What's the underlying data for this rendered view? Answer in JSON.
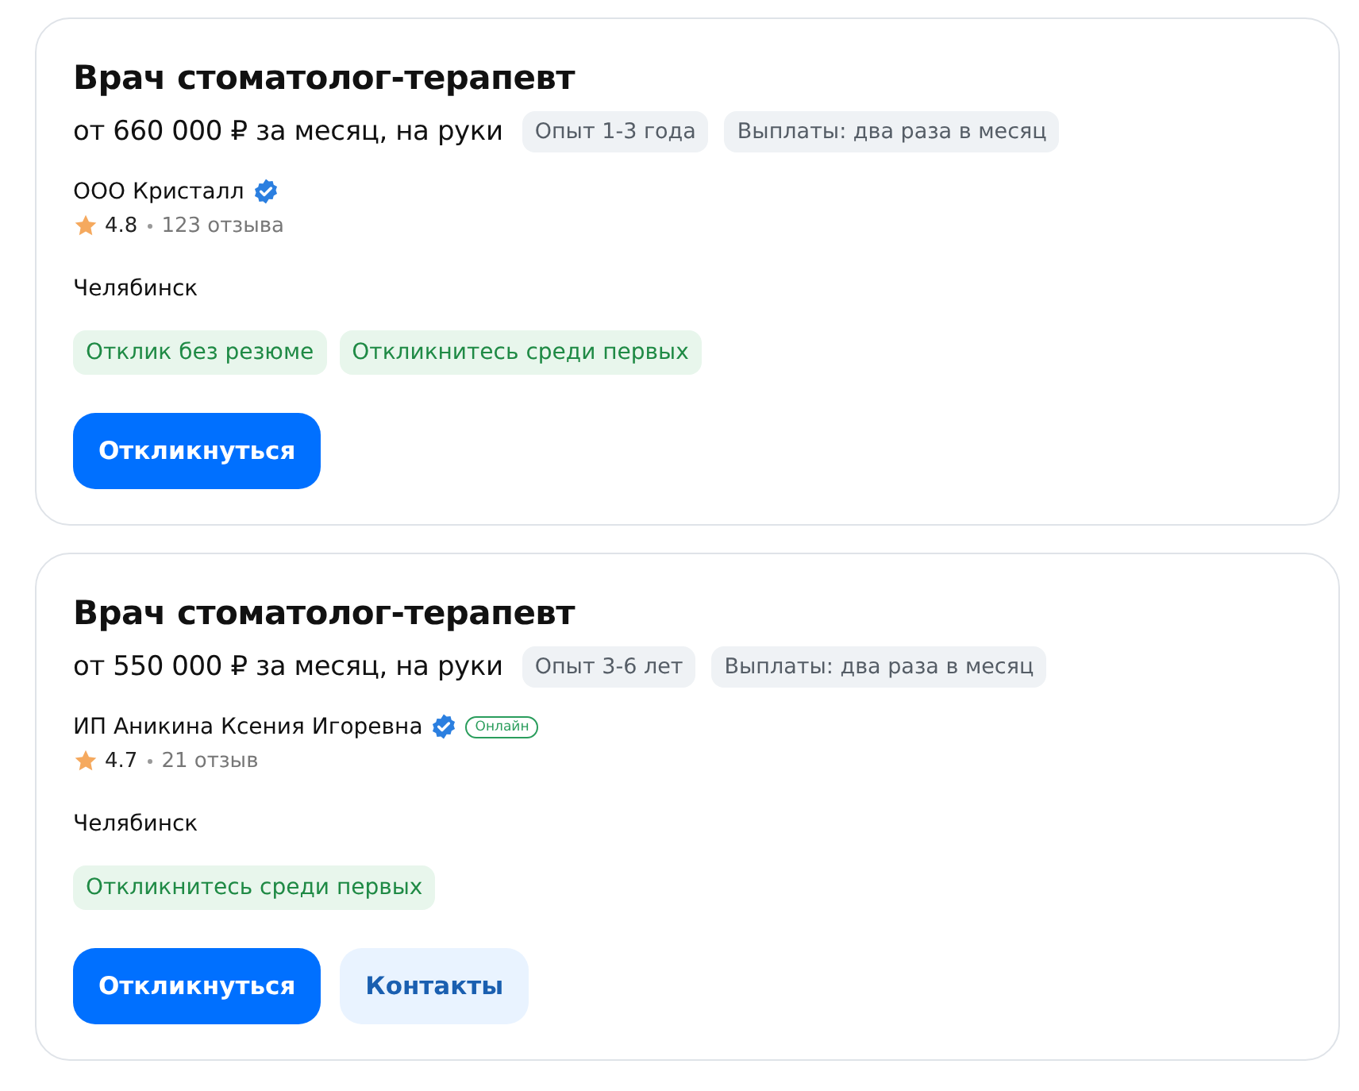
{
  "vacancies": [
    {
      "title": "Врач стоматолог-терапевт",
      "salary": "от 660 000 ₽ за месяц, на руки",
      "chips": [
        "Опыт 1-3 года",
        "Выплаты: два раза в месяц"
      ],
      "company": "ООО Кристалл",
      "verified": true,
      "online": false,
      "rating": "4.8",
      "reviews": "123 отзыва",
      "city": "Челябинск",
      "tags": [
        "Отклик без резюме",
        "Откликнитесь среди первых"
      ],
      "buttons": [
        {
          "label": "Откликнуться",
          "kind": "primary"
        }
      ]
    },
    {
      "title": "Врач стоматолог-терапевт",
      "salary": "от 550 000 ₽ за месяц, на руки",
      "chips": [
        "Опыт 3-6 лет",
        "Выплаты: два раза в месяц"
      ],
      "company": "ИП Аникина Ксения Игоревна",
      "verified": true,
      "online": true,
      "online_label": "Онлайн",
      "rating": "4.7",
      "reviews": "21 отзыв",
      "city": "Челябинск",
      "tags": [
        "Откликнитесь среди первых"
      ],
      "buttons": [
        {
          "label": "Откликнуться",
          "kind": "primary"
        },
        {
          "label": "Контакты",
          "kind": "secondary"
        }
      ]
    }
  ]
}
